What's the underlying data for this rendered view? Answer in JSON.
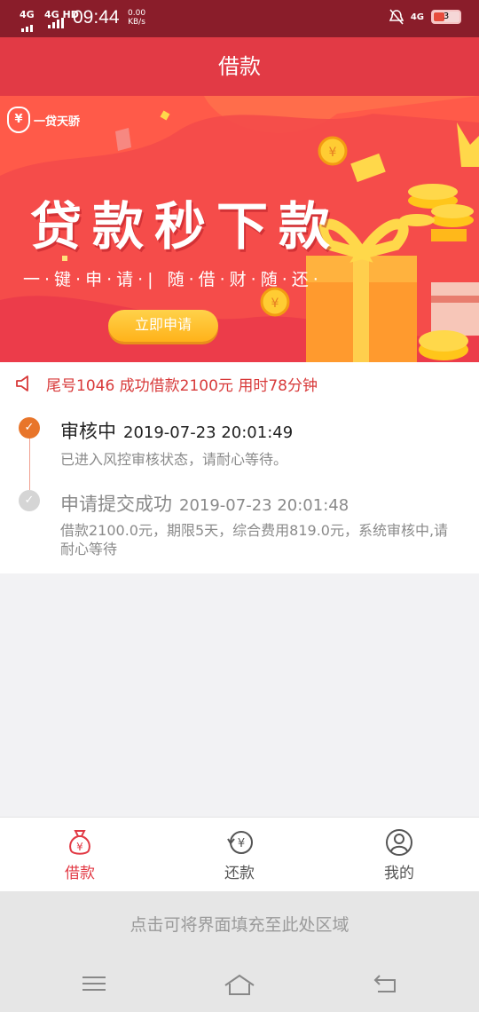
{
  "status_bar": {
    "signal1": "4G",
    "signal2": "4G HD",
    "time": "09:44",
    "speed_value": "0.00",
    "speed_unit": "KB/s",
    "network_right": "4G",
    "battery": "3"
  },
  "header": {
    "title": "借款"
  },
  "banner": {
    "brand": "一贷天骄",
    "title": "贷款秒下款",
    "subtitle": "一·键·申·请·| 随·借·财·随·还·",
    "cta": "立即申请"
  },
  "notice": {
    "text": "尾号1046 成功借款2100元 用时78分钟"
  },
  "timeline": [
    {
      "title": "审核中",
      "time": "2019-07-23 20:01:49",
      "desc": "已进入风控审核状态，请耐心等待。",
      "status": "active"
    },
    {
      "title": "申请提交成功",
      "time": "2019-07-23 20:01:48",
      "desc": "借款2100.0元，期限5天，综合费用819.0元，系统审核中,请耐心等待",
      "status": "done"
    }
  ],
  "bottom_nav": [
    {
      "label": "借款",
      "icon": "money-bag-icon",
      "active": true
    },
    {
      "label": "还款",
      "icon": "repay-icon",
      "active": false
    },
    {
      "label": "我的",
      "icon": "user-icon",
      "active": false
    }
  ],
  "fill_hint": "点击可将界面填充至此处区域",
  "colors": {
    "accent": "#e23a45",
    "status_bar": "#8a1d2a",
    "active_dot": "#e8752a"
  }
}
